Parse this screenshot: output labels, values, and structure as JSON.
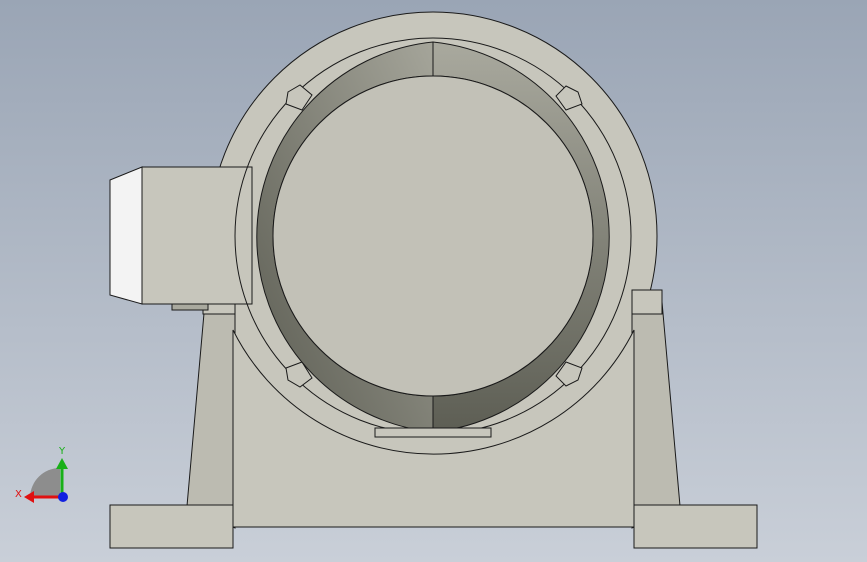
{
  "viewport": {
    "background_top": "#9aa5b5",
    "background_bottom": "#c9cfd8"
  },
  "model": {
    "body_color": "#c7c6bc",
    "body_shade": "#b9b8ad",
    "edge_color": "#1a1a1a",
    "ring_light": "#a9a99e",
    "ring_dark": "#5d5e54",
    "terminal_box_face": "#f3f3f3"
  },
  "triad": {
    "x_label": "X",
    "y_label": "Y",
    "x_color": "#e01010",
    "y_color": "#18b018",
    "z_color": "#1020e0",
    "plane_color": "#8d8d8d"
  }
}
